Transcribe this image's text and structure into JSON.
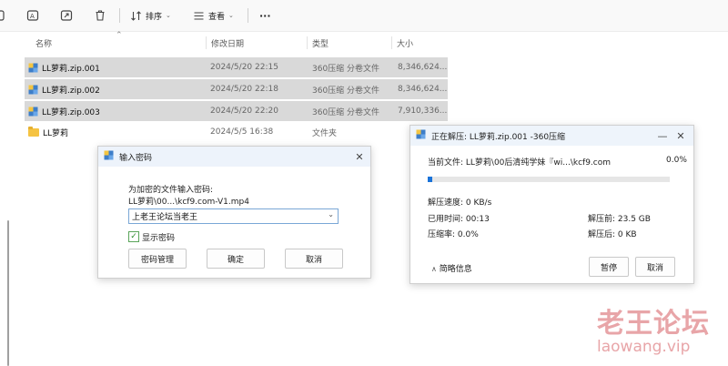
{
  "toolbar": {
    "sort_label": "排序",
    "view_label": "查看",
    "more_label": "···"
  },
  "columns": {
    "name": "名称",
    "date": "修改日期",
    "type": "类型",
    "size": "大小"
  },
  "files": [
    {
      "name": "LL萝莉.zip.001",
      "date": "2024/5/20 22:15",
      "type": "360压缩 分卷文件",
      "size": "8,346,624..."
    },
    {
      "name": "LL萝莉.zip.002",
      "date": "2024/5/20 22:18",
      "type": "360压缩 分卷文件",
      "size": "8,346,624..."
    },
    {
      "name": "LL萝莉.zip.003",
      "date": "2024/5/20 22:20",
      "type": "360压缩 分卷文件",
      "size": "7,910,336..."
    },
    {
      "name": "LL萝莉",
      "date": "2024/5/5 16:38",
      "type": "文件夹",
      "size": ""
    }
  ],
  "password_dialog": {
    "title": "输入密码",
    "prompt": "为加密的文件输入密码:",
    "file": "LL萝莉\\00...\\kcf9.com-V1.mp4",
    "password_value": "上老王论坛当老王",
    "show_password_label": "显示密码",
    "show_password_checked": true,
    "manage_button": "密码管理",
    "ok_button": "确定",
    "cancel_button": "取消"
  },
  "extract_dialog": {
    "title": "正在解压: LL萝莉.zip.001 -360压缩",
    "current_file_label": "当前文件: LL萝莉\\00后清纯学妹『wi...\\kcf9.com",
    "percent": "0.0%",
    "progress": 0.02,
    "speed": "解压速度: 0 KB/s",
    "elapsed": "已用时间: 00:13",
    "ratio": "压缩率:   0.0%",
    "before": "解压前: 23.5 GB",
    "after": "解压后: 0 KB",
    "brief_label": "简略信息",
    "pause_button": "暂停",
    "cancel_button": "取消"
  },
  "watermark": {
    "cn": "老王论坛",
    "en": "laowang.vip"
  },
  "colors": {
    "selection": "#d9d9d9",
    "progress": "#1a73d9",
    "watermark": "#e8a5a8",
    "accent_border": "#7aa7d6"
  }
}
